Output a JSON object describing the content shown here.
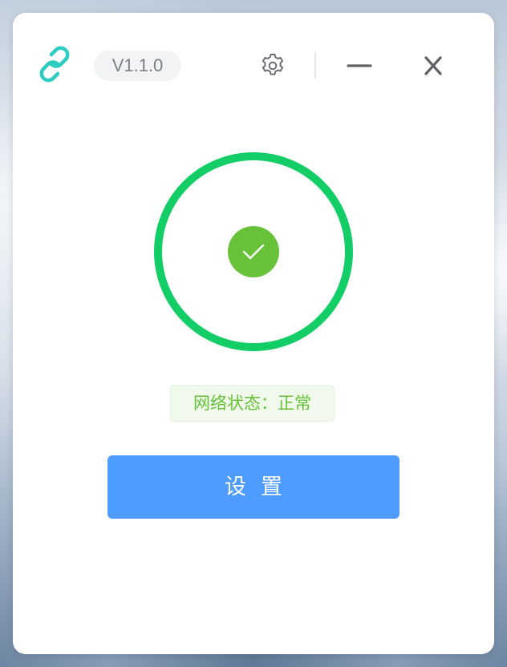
{
  "window": {
    "version": "V1.1.0"
  },
  "icons": {
    "logo": "link-icon",
    "settings": "gear-icon",
    "minimize": "minimize-icon",
    "close": "close-icon",
    "status": "checkmark-icon"
  },
  "status": {
    "text": "网络状态：正常"
  },
  "actions": {
    "settings_label": "设置"
  },
  "colors": {
    "accent_teal": "#2ccdc0",
    "ring_green": "#13ce66",
    "check_green": "#67c23a",
    "button_blue": "#4e9cff"
  }
}
